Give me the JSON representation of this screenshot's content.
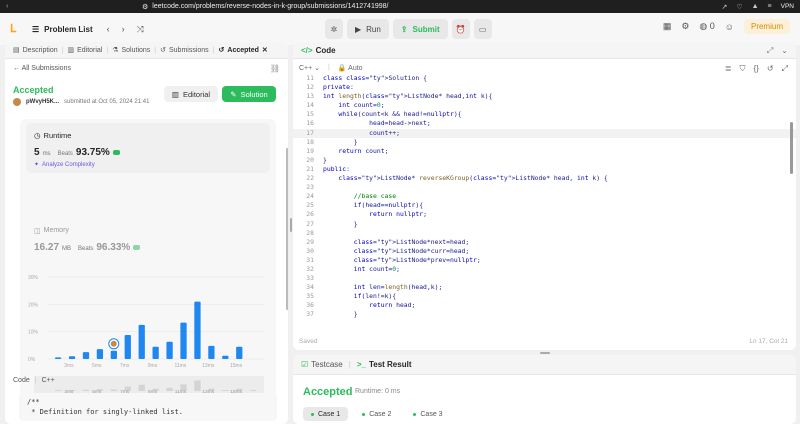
{
  "browser": {
    "url": "leetcode.com/problems/reverse-nodes-in-k-group/submissions/1412741998/",
    "vpn_label": "VPN"
  },
  "topnav": {
    "problem_list": "Problem List",
    "run": "Run",
    "submit": "Submit",
    "streak": "0",
    "premium": "Premium"
  },
  "left": {
    "tabs": [
      "Description",
      "Editorial",
      "Solutions",
      "Submissions",
      "Accepted"
    ],
    "all_submissions": "All Submissions",
    "status": "Accepted",
    "username": "pWvyH5K...",
    "submitted_at": "submitted at Oct 05, 2024 21:41",
    "editorial_btn": "Editorial",
    "solution_btn": "Solution",
    "runtime": {
      "label": "Runtime",
      "value": "5",
      "unit": "ms",
      "beats_label": "Beats",
      "beats_value": "93.75%",
      "analyze": "Analyze Complexity"
    },
    "memory": {
      "label": "Memory",
      "value": "16.27",
      "unit": "MB",
      "beats_label": "Beats",
      "beats_value": "96.33%"
    },
    "code_label": "Code",
    "code_lang": "C++",
    "code_preview": [
      "/**",
      " * Definition for singly-linked list."
    ]
  },
  "chart_data": {
    "type": "bar",
    "ylabel_ticks": [
      "30%",
      "20%",
      "10%",
      "0%"
    ],
    "ylim": [
      0,
      30
    ],
    "x_ticks": [
      "3ms",
      "5ms",
      "7ms",
      "9ms",
      "11ms",
      "13ms",
      "15ms"
    ],
    "bar_x": [
      1,
      2,
      3,
      4,
      5,
      6,
      7,
      8,
      9,
      10,
      11,
      12,
      13,
      14,
      15
    ],
    "values": [
      0.6,
      1,
      2.5,
      3.6,
      3.0,
      8.8,
      12.5,
      4.5,
      6.3,
      13.3,
      21.0,
      4.8,
      1.2,
      4.5,
      0
    ],
    "highlight_x": 5,
    "overview_ticks": [
      "3ms",
      "5ms",
      "7ms",
      "9ms",
      "11ms",
      "13ms",
      "15ms"
    ]
  },
  "editor": {
    "title": "Code",
    "language": "C++",
    "mode": "Auto",
    "saved": "Saved",
    "position": "Ln 17, Col 21",
    "lines": [
      {
        "n": "11",
        "t": "class Solution {"
      },
      {
        "n": "12",
        "t": "private:"
      },
      {
        "n": "13",
        "t": "int length(ListNode* head,int k){"
      },
      {
        "n": "14",
        "t": "    int count=0;"
      },
      {
        "n": "15",
        "t": "    while(count<k && head!=nullptr){"
      },
      {
        "n": "16",
        "t": "            head=head->next;"
      },
      {
        "n": "17",
        "t": "            count++;"
      },
      {
        "n": "18",
        "t": "        }"
      },
      {
        "n": "19",
        "t": "    return count;"
      },
      {
        "n": "20",
        "t": "}"
      },
      {
        "n": "21",
        "t": "public:"
      },
      {
        "n": "22",
        "t": "    ListNode* reverseKGroup(ListNode* head, int k) {"
      },
      {
        "n": "23",
        "t": ""
      },
      {
        "n": "24",
        "t": "        //base case"
      },
      {
        "n": "25",
        "t": "        if(head==nullptr){"
      },
      {
        "n": "26",
        "t": "            return nullptr;"
      },
      {
        "n": "27",
        "t": "        }"
      },
      {
        "n": "28",
        "t": ""
      },
      {
        "n": "29",
        "t": "        ListNode*next=head;"
      },
      {
        "n": "30",
        "t": "        ListNode*curr=head;"
      },
      {
        "n": "31",
        "t": "        ListNode*prev=nullptr;"
      },
      {
        "n": "32",
        "t": "        int count=0;"
      },
      {
        "n": "33",
        "t": ""
      },
      {
        "n": "34",
        "t": "        int len=length(head,k);"
      },
      {
        "n": "35",
        "t": "        if(len!=k){"
      },
      {
        "n": "36",
        "t": "            return head;"
      },
      {
        "n": "37",
        "t": "        }"
      }
    ]
  },
  "test": {
    "tab_testcase": "Testcase",
    "tab_result": "Test Result",
    "status": "Accepted",
    "runtime": "Runtime: 0 ms",
    "cases": [
      "Case 1",
      "Case 2",
      "Case 3"
    ]
  }
}
